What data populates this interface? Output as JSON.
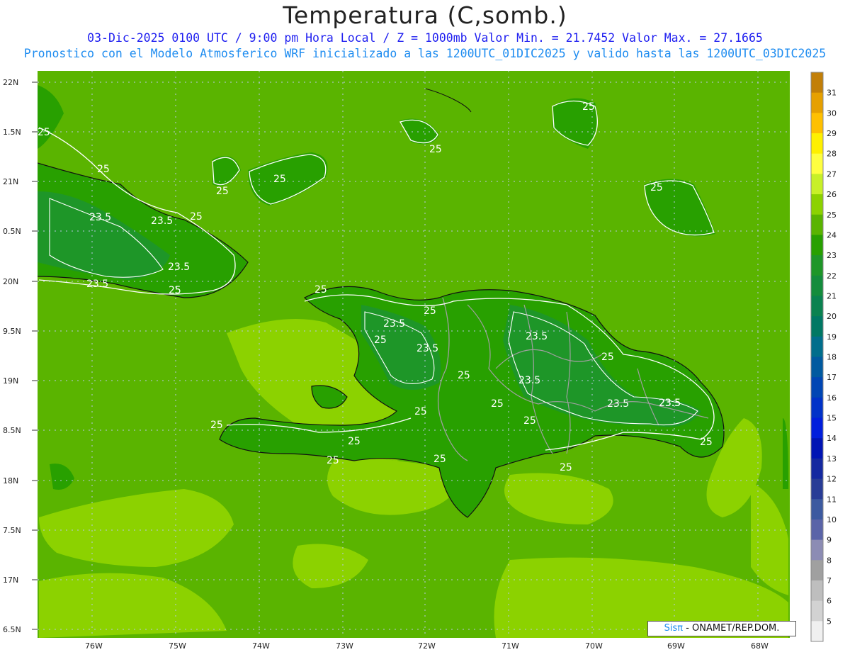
{
  "title": "Temperatura (C,somb.)",
  "subtitle_line1": "03-Dic-2025  0100 UTC / 9:00 pm Hora Local / Z = 1000mb   Valor Min. = 21.7452  Valor Max. = 27.1665",
  "subtitle_line2": "Pronostico con el Modelo Atmosferico WRF inicializado a las 1200UTC_01DIC2025 y valido hasta las  1200UTC_03DIC2025",
  "credit": {
    "brand": "Sisπ",
    "text": "- ONAMET/REP.DOM."
  },
  "lat_labels": [
    "22N",
    "1.5N",
    "21N",
    "0.5N",
    "20N",
    "9.5N",
    "19N",
    "8.5N",
    "18N",
    "7.5N",
    "17N",
    "6.5N"
  ],
  "lon_labels": [
    "76W",
    "75W",
    "74W",
    "73W",
    "72W",
    "71W",
    "70W",
    "69W",
    "68W"
  ],
  "colorbar": {
    "levels": [
      "31",
      "30",
      "29",
      "28",
      "27",
      "26",
      "25",
      "24",
      "23",
      "22",
      "21",
      "20",
      "19",
      "18",
      "17",
      "16",
      "15",
      "14",
      "13",
      "12",
      "11",
      "10",
      "9",
      "8",
      "7",
      "6",
      "5"
    ],
    "colors": [
      "#c27f08",
      "#e6a000",
      "#ffc000",
      "#fff000",
      "#ffff40",
      "#c8f028",
      "#8cd200",
      "#5ab400",
      "#28a000",
      "#1e9628",
      "#148c3c",
      "#0a8250",
      "#007864",
      "#006e8c",
      "#005aa0",
      "#0046b4",
      "#0032c8",
      "#001edc",
      "#0014b4",
      "#1428a0",
      "#283c96",
      "#3c5aa0",
      "#5a64a8",
      "#8c8cb4",
      "#a0a0a0",
      "#bebebe",
      "#d2d2d2",
      "#f0f0f0"
    ]
  },
  "contour_labels": [
    "25",
    "25",
    "25",
    "25",
    "25",
    "25",
    "25",
    "23.5",
    "23.5",
    "23.5",
    "23.5",
    "25",
    "25",
    "23.5",
    "23.5",
    "25",
    "25",
    "25",
    "23.5",
    "23.5",
    "23.5",
    "25",
    "25",
    "25",
    "25",
    "25",
    "25",
    "25",
    "25",
    "25",
    "23.5",
    "25",
    "23.5",
    "25"
  ]
}
